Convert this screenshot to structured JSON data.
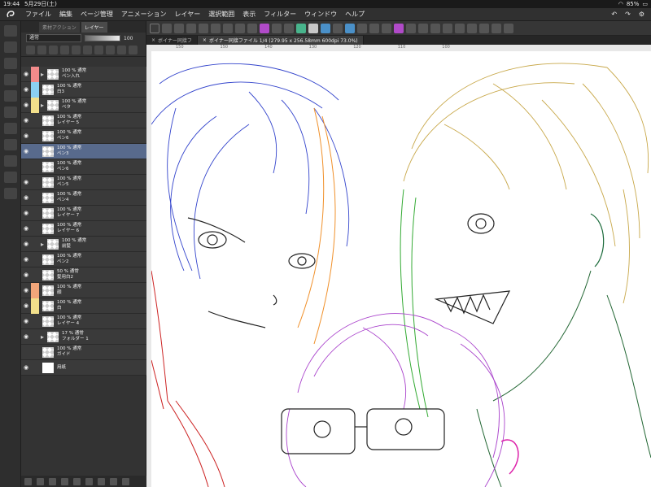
{
  "status": {
    "time": "19:44",
    "date": "5月29日(土)",
    "battery": "85%"
  },
  "menu": [
    "ファイル",
    "編集",
    "ページ管理",
    "アニメーション",
    "レイヤー",
    "選択範囲",
    "表示",
    "フィルター",
    "ウィンドウ",
    "ヘルプ"
  ],
  "tabs": [
    {
      "label": "ボイナー同接フ"
    },
    {
      "label": "ボイナー同接ファイル 1/4 (279.95 x 256.58mm 600dpi 73.0%)"
    }
  ],
  "panel": {
    "tab_material": "素材アクション",
    "tab_layer": "レイヤー",
    "blend": "通常",
    "opacity": "100"
  },
  "layers": [
    {
      "eye": true,
      "color": "#f28b8b",
      "folder": true,
      "l1": "100 % 通常",
      "l2": "ペン入れ"
    },
    {
      "eye": true,
      "color": "#8bd0f2",
      "l1": "100 % 通常",
      "l2": "白3"
    },
    {
      "eye": true,
      "color": "#f2e08b",
      "folder": true,
      "l1": "100 % 通常",
      "l2": "ベタ"
    },
    {
      "eye": true,
      "l1": "100 % 通常",
      "l2": "レイヤー 5"
    },
    {
      "eye": true,
      "l1": "100 % 通常",
      "l2": "ペン6"
    },
    {
      "eye": true,
      "sel": true,
      "l1": "100 % 通常",
      "l2": "ペン3"
    },
    {
      "eye": false,
      "l1": "100 % 通常",
      "l2": "ペン6"
    },
    {
      "eye": true,
      "l1": "100 % 通常",
      "l2": "ペン5"
    },
    {
      "eye": true,
      "l1": "100 % 通常",
      "l2": "ペン4"
    },
    {
      "eye": true,
      "l1": "100 % 通常",
      "l2": "レイヤー 7"
    },
    {
      "eye": true,
      "l1": "100 % 通常",
      "l2": "レイヤー 6"
    },
    {
      "eye": true,
      "folder": true,
      "l1": "100 % 通常",
      "l2": "前髪"
    },
    {
      "eye": true,
      "l1": "100 % 通常",
      "l2": "ペン2"
    },
    {
      "eye": true,
      "l1": "50 % 通常",
      "l2": "髪用白2"
    },
    {
      "eye": true,
      "color": "#f2a67a",
      "l1": "100 % 通常",
      "l2": "顔"
    },
    {
      "eye": true,
      "color": "#f2e08b",
      "l1": "100 % 通常",
      "l2": "白"
    },
    {
      "eye": true,
      "l1": "100 % 通常",
      "l2": "レイヤー 4"
    },
    {
      "eye": true,
      "folder": true,
      "l1": "17 % 通常",
      "l2": "フォルダー 1"
    },
    {
      "eye": false,
      "l1": "100 % 通常",
      "l2": "ガイド"
    },
    {
      "eye": true,
      "l1": "",
      "l2": "用紙"
    }
  ]
}
